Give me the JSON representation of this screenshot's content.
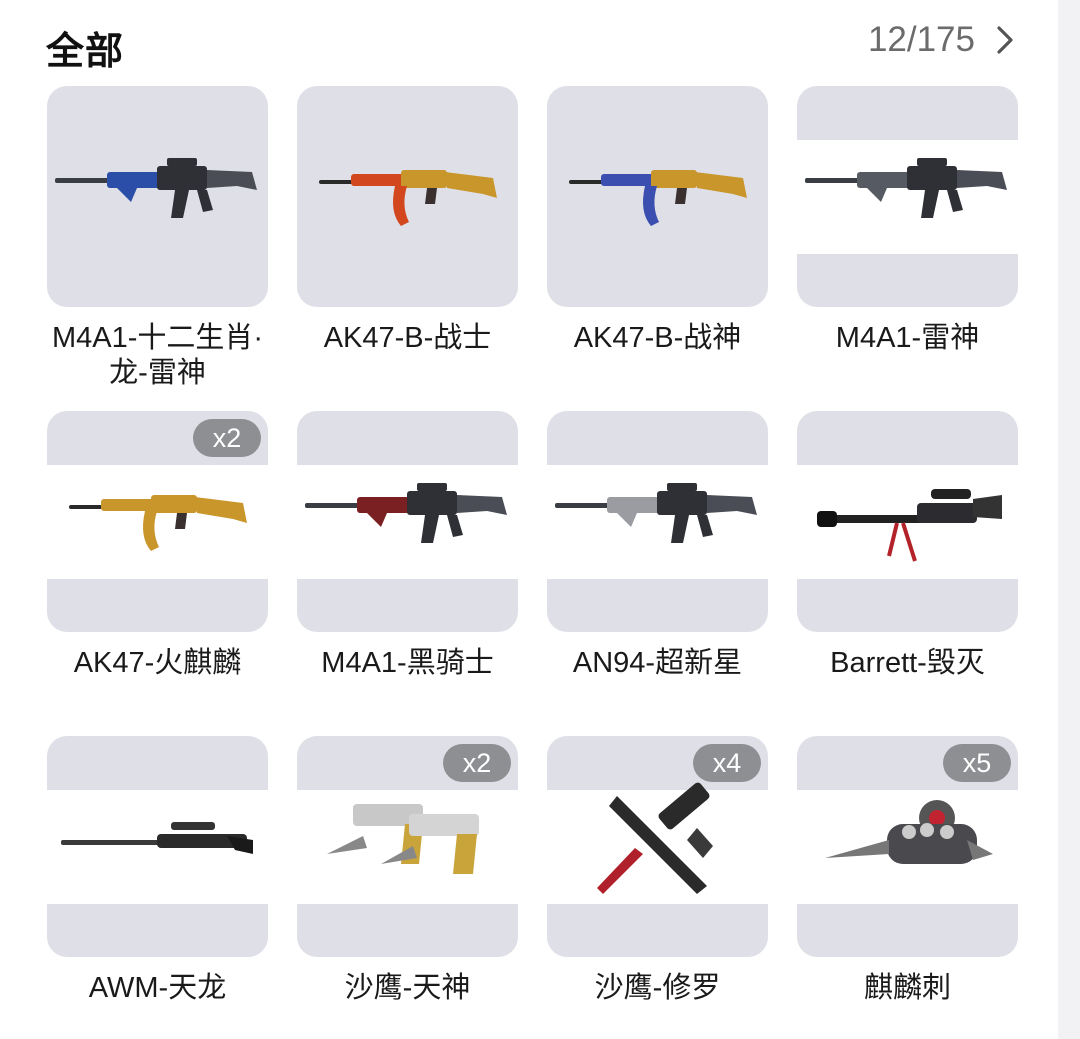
{
  "header": {
    "title": "全部",
    "page_count": "12/175"
  },
  "items": [
    {
      "name": "M4A1-十二生肖·龙-雷神",
      "badge": "",
      "icon": "rifle-m4a1-dragon-icon",
      "accent": "#2b4fa8",
      "kind": "rifle",
      "strip": false
    },
    {
      "name": "AK47-B-战士",
      "badge": "",
      "icon": "rifle-ak47-warrior-icon",
      "accent": "#d3471f",
      "kind": "ak",
      "strip": false
    },
    {
      "name": "AK47-B-战神",
      "badge": "",
      "icon": "rifle-ak47-wargod-icon",
      "accent": "#3a4fb0",
      "kind": "ak",
      "strip": false
    },
    {
      "name": "M4A1-雷神",
      "badge": "",
      "icon": "rifle-m4a1-thor-icon",
      "accent": "#555a63",
      "kind": "rifle",
      "strip": true
    },
    {
      "name": "AK47-火麒麟",
      "badge": "x2",
      "icon": "rifle-ak47-fire-qilin-icon",
      "accent": "#c9962b",
      "kind": "ak",
      "strip": true
    },
    {
      "name": "M4A1-黑骑士",
      "badge": "",
      "icon": "rifle-m4a1-dark-knight-icon",
      "accent": "#7a1f22",
      "kind": "rifle",
      "strip": true
    },
    {
      "name": "AN94-超新星",
      "badge": "",
      "icon": "rifle-an94-supernova-icon",
      "accent": "#9a9ca2",
      "kind": "rifle",
      "strip": true
    },
    {
      "name": "Barrett-毁灭",
      "badge": "",
      "icon": "sniper-barrett-destruction-icon",
      "accent": "#b32228",
      "kind": "sniper",
      "strip": true
    },
    {
      "name": "AWM-天龙",
      "badge": "",
      "icon": "sniper-awm-dragon-icon",
      "accent": "#2a2a2a",
      "kind": "awm",
      "strip": true
    },
    {
      "name": "沙鹰-天神",
      "badge": "x2",
      "icon": "pistol-desert-eagle-god-icon",
      "accent": "#c9a43a",
      "kind": "pistol",
      "strip": true
    },
    {
      "name": "沙鹰-修罗",
      "badge": "x4",
      "icon": "pistol-desert-eagle-asura-icon",
      "accent": "#b0202a",
      "kind": "pistol-knife",
      "strip": true
    },
    {
      "name": "麒麟刺",
      "badge": "x5",
      "icon": "knuckle-qilin-thorn-icon",
      "accent": "#c22330",
      "kind": "knuckle",
      "strip": true
    }
  ]
}
